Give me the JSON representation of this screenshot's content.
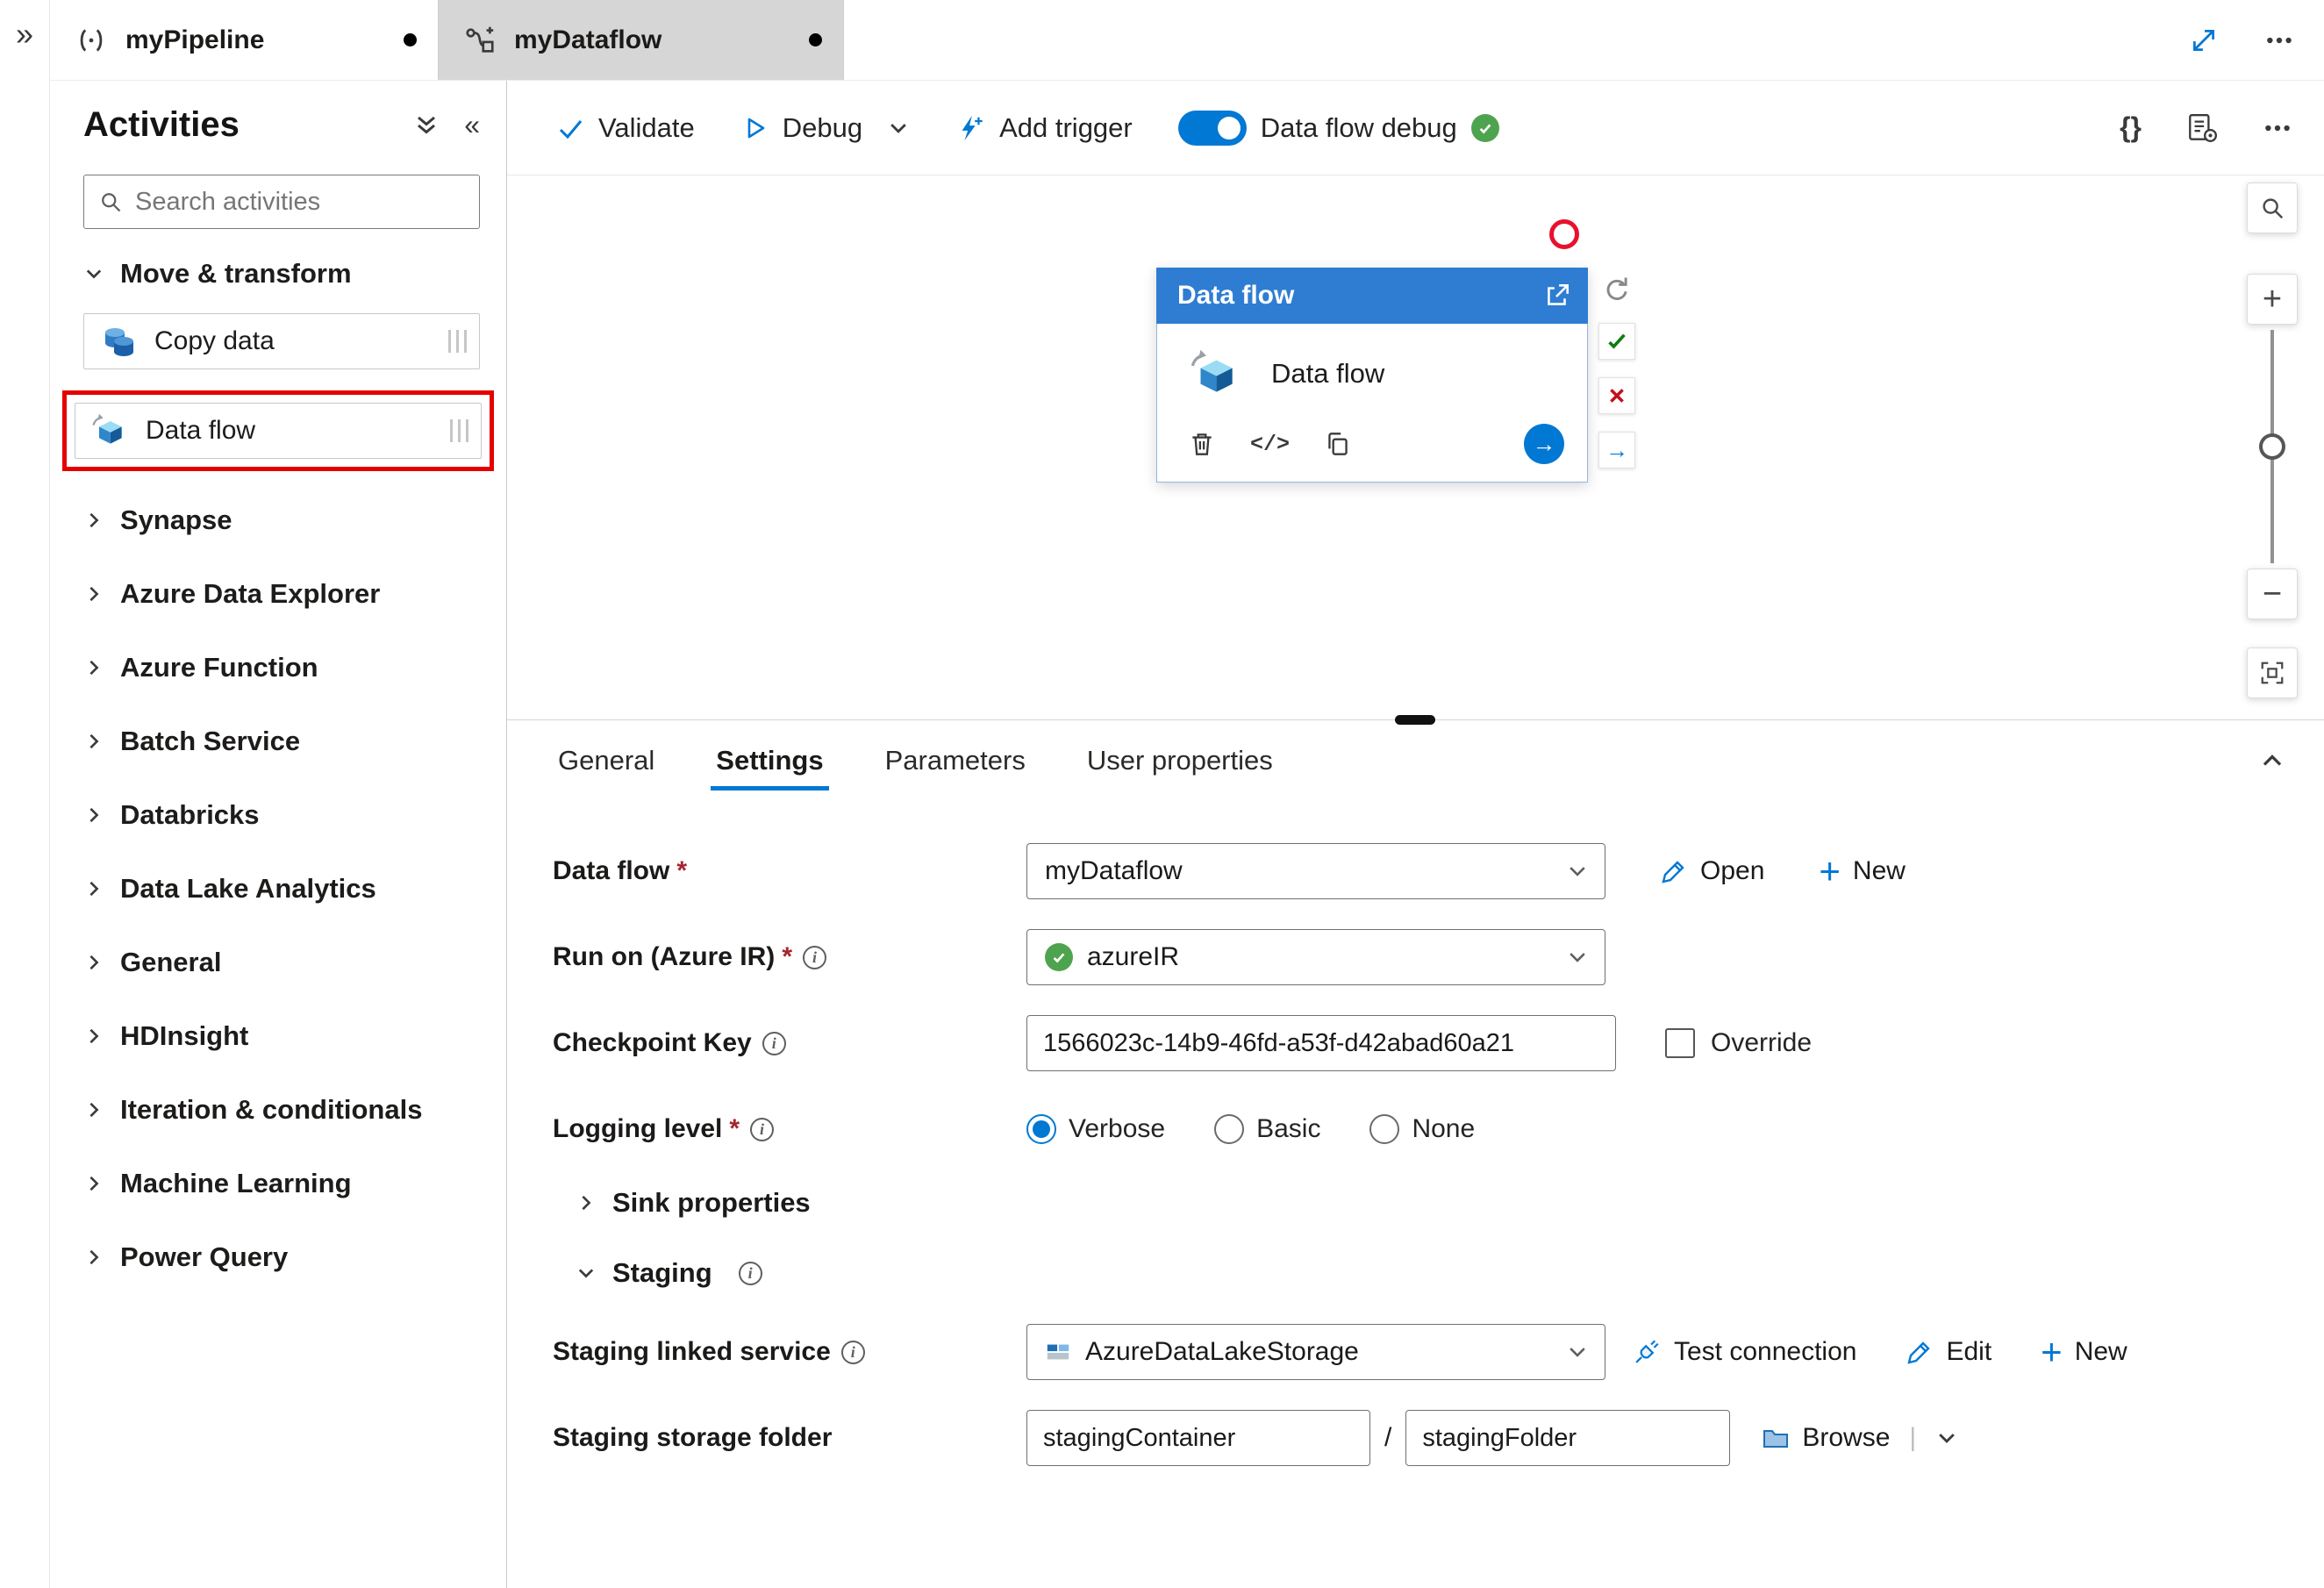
{
  "glyphs": {
    "collapse_right": "»",
    "collapse_left": "«",
    "plus": "+",
    "minus": "−",
    "arrow_right": "→",
    "braces": "{}",
    "code": "</>",
    "slash": "/",
    "pipe": "|",
    "asterisk": "*",
    "info": "i"
  },
  "tabs": {
    "pipeline": "myPipeline",
    "dataflow": "myDataflow"
  },
  "sidebar": {
    "title": "Activities",
    "search_placeholder": "Search activities",
    "expanded_group": "Move & transform",
    "copy_data": "Copy data",
    "data_flow": "Data flow",
    "collapsed_groups": [
      "Synapse",
      "Azure Data Explorer",
      "Azure Function",
      "Batch Service",
      "Databricks",
      "Data Lake Analytics",
      "General",
      "HDInsight",
      "Iteration & conditionals",
      "Machine Learning",
      "Power Query"
    ]
  },
  "toolbar": {
    "validate": "Validate",
    "debug": "Debug",
    "add_trigger": "Add trigger",
    "dataflow_debug": "Data flow debug"
  },
  "node": {
    "header": "Data flow",
    "label": "Data flow"
  },
  "panel": {
    "tabs": [
      "General",
      "Settings",
      "Parameters",
      "User properties"
    ],
    "data_flow": {
      "label": "Data flow",
      "value": "myDataflow",
      "open": "Open",
      "new": "New"
    },
    "run_on": {
      "label": "Run on (Azure IR)",
      "value": "azureIR"
    },
    "checkpoint": {
      "label": "Checkpoint Key",
      "value": "1566023c-14b9-46fd-a53f-d42abad60a21",
      "override": "Override"
    },
    "logging": {
      "label": "Logging level",
      "verbose": "Verbose",
      "basic": "Basic",
      "none": "None"
    },
    "sink": "Sink properties",
    "staging": "Staging",
    "linked_service": {
      "label": "Staging linked service",
      "value": "AzureDataLakeStorage",
      "test": "Test connection",
      "edit": "Edit",
      "new": "New"
    },
    "storage_folder": {
      "label": "Staging storage folder",
      "container": "stagingContainer",
      "folder": "stagingFolder",
      "browse": "Browse"
    }
  }
}
